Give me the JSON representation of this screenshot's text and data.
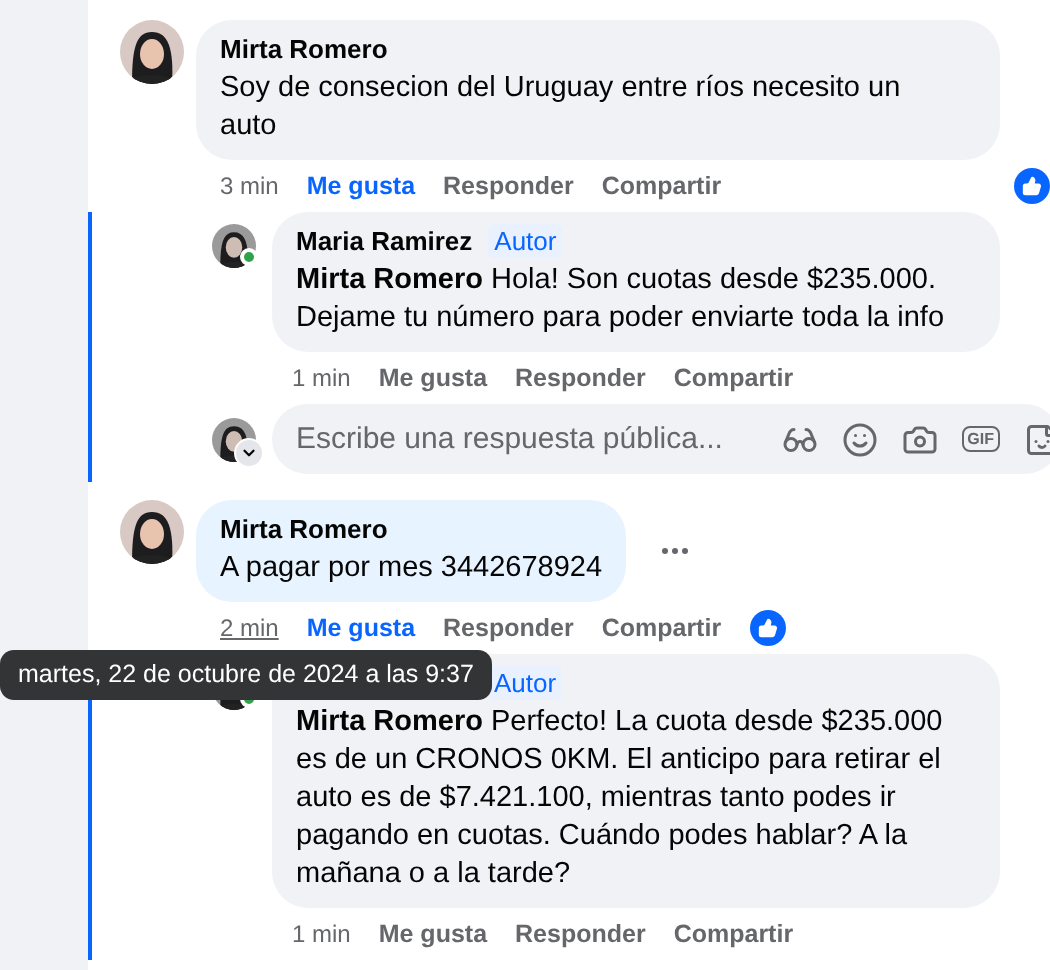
{
  "comments": [
    {
      "author": "Mirta Romero",
      "text": "Soy de consecion del Uruguay entre ríos necesito un auto",
      "highlighted": false,
      "menu_shown": false,
      "time": "3 min",
      "time_hovered": false,
      "liked": true,
      "actions": [
        {
          "label": "Me gusta",
          "selected": true
        },
        {
          "label": "Responder",
          "selected": false
        },
        {
          "label": "Compartir",
          "selected": false
        }
      ],
      "replies": [
        {
          "author": "Maria Ramirez",
          "badge": "Autor",
          "online": true,
          "text": "**Mirta Romero** Hola! Son cuotas desde $235.000. Dejame tu número para poder enviarte toda la info",
          "time": "1 min",
          "actions": [
            {
              "label": "Me gusta",
              "selected": false
            },
            {
              "label": "Responder",
              "selected": false
            },
            {
              "label": "Compartir",
              "selected": false
            }
          ]
        }
      ],
      "composer": {
        "placeholder": "Escribe una respuesta pública...",
        "gif_label": "GIF"
      }
    },
    {
      "author": "Mirta Romero",
      "text": "A pagar por mes 3442678924",
      "highlighted": true,
      "menu_shown": true,
      "time": "2 min",
      "time_hovered": true,
      "liked": true,
      "actions": [
        {
          "label": "Me gusta",
          "selected": true
        },
        {
          "label": "Responder",
          "selected": false
        },
        {
          "label": "Compartir",
          "selected": false
        }
      ],
      "replies": [
        {
          "badge": "Autor",
          "online": true,
          "text": "**Mirta Romero** Perfecto! La cuota desde $235.000 es de un CRONOS 0KM. El anticipo para retirar el auto es de $7.421.100, mientras tanto podes ir pagando en cuotas. Cuándo podes hablar? A la mañana o a la tarde?",
          "time": "1 min",
          "actions": [
            {
              "label": "Me gusta",
              "selected": false
            },
            {
              "label": "Responder",
              "selected": false
            },
            {
              "label": "Compartir",
              "selected": false
            }
          ]
        }
      ]
    }
  ],
  "tooltip": {
    "text": "martes, 22 de octubre de 2024 a las 9:37"
  }
}
